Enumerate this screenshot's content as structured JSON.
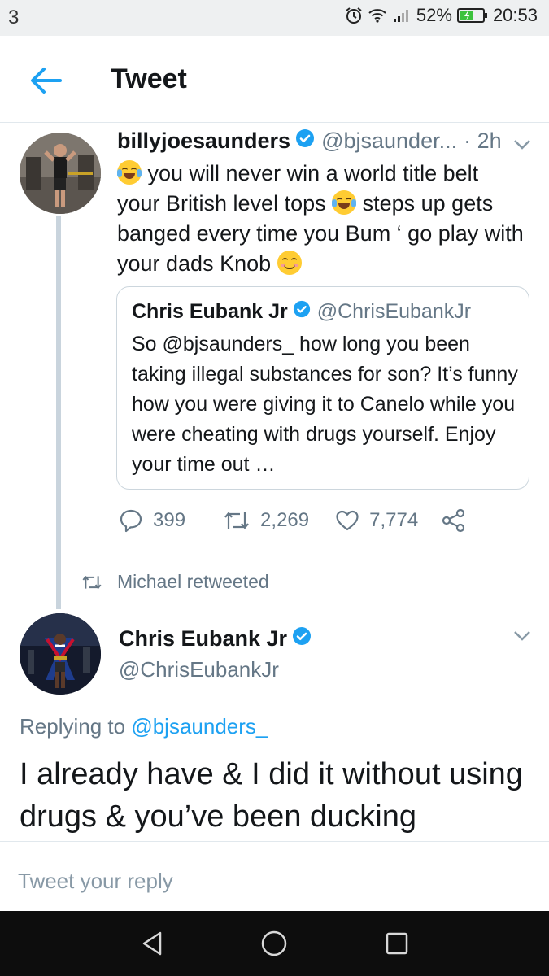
{
  "status_bar": {
    "notification_count": "3",
    "battery": "52%",
    "time": "20:53",
    "icons": [
      "alarm-icon",
      "wifi-icon",
      "signal-icon",
      "battery-icon"
    ]
  },
  "header": {
    "title": "Tweet",
    "back_icon": "arrow-left-icon"
  },
  "colors": {
    "accent": "#1da1f2",
    "text": "#14171a",
    "secondary": "#657786",
    "border": "#ccd6dd"
  },
  "quoting_tweet": {
    "name": "billyjoesaunders",
    "handle": "@bjsaunder...",
    "time": "· 2h",
    "text_1": " you will never win a world title belt your British level tops ",
    "text_2": " steps up gets banged every time you Bum ‘ go play with your dads Knob ",
    "emojis": [
      "face-with-tears-of-joy",
      "face-with-tears-of-joy",
      "smiling-face-with-smiling-eyes"
    ],
    "quote": {
      "name": "Chris Eubank Jr",
      "handle": "@ChrisEubankJr",
      "text": "So @bjsaunders_ how long you been taking illegal substances for son? It’s funny how you were giving it to Canelo while you were cheating with drugs yourself. Enjoy your time out …"
    },
    "actions": {
      "replies": "399",
      "retweets": "2,269",
      "likes": "7,774"
    }
  },
  "retweet_note": "Michael retweeted",
  "main_tweet": {
    "name": "Chris Eubank Jr",
    "handle": "@ChrisEubankJr",
    "replying_prefix": "Replying to ",
    "replying_to": "@bjsaunders_",
    "text": "I already have & I did it without using drugs & you’ve been ducking"
  },
  "reply": {
    "placeholder": "Tweet your reply"
  },
  "nav": {
    "icons": [
      "back-triangle-icon",
      "home-circle-icon",
      "recents-square-icon"
    ]
  }
}
